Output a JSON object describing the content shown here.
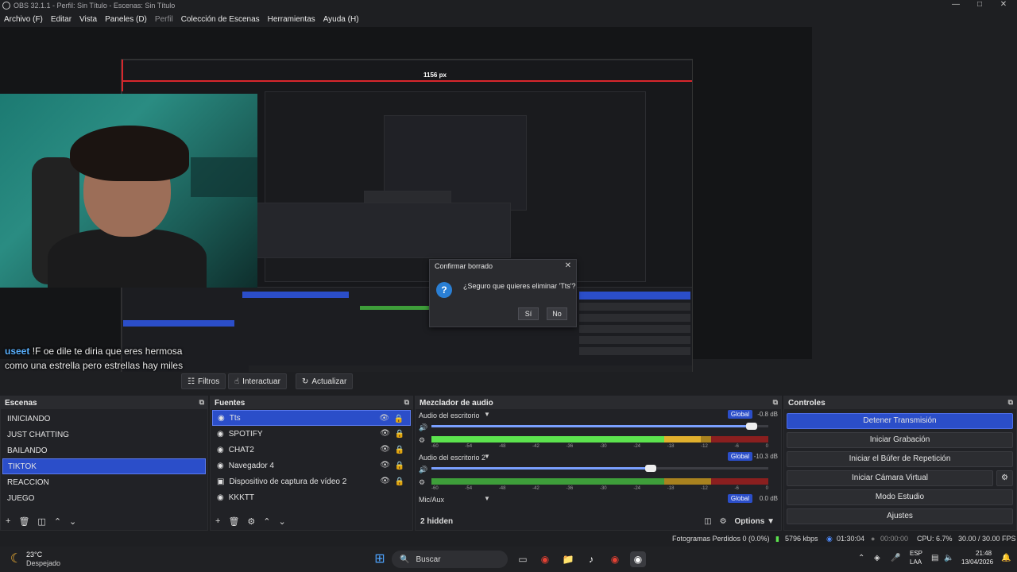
{
  "window": {
    "title": "OBS 32.1.1 - Perfil: Sin Título - Escenas: Sin Título"
  },
  "menu": [
    "Archivo (F)",
    "Editar",
    "Vista",
    "Paneles (D)",
    "Perfil",
    "Colección de Escenas",
    "Herramientas",
    "Ayuda (H)"
  ],
  "preview": {
    "measure_label": "1156 px"
  },
  "confirm": {
    "title": "Confirmar borrado",
    "message": "¿Seguro que quieres eliminar 'Tts'?",
    "yes": "Sí",
    "no": "No"
  },
  "chat": {
    "user": "useet",
    "message": "!F oe dile te diria que eres hermosa como una estrella pero estrellas hay miles mejor te digo que eres unica como la luna"
  },
  "toolbar": {
    "filters": "Filtros",
    "interact": "Interactuar",
    "refresh": "Actualizar"
  },
  "scenes": {
    "title": "Escenas",
    "items": [
      "IINICIANDO",
      "JUST CHATTING",
      "BAILANDO",
      "TIKTOK",
      "REACCION",
      "JUEGO"
    ],
    "selected_index": 3
  },
  "sources": {
    "title": "Fuentes",
    "items": [
      "Tts",
      "SPOTIFY",
      "CHAT2",
      "Navegador 4",
      "Dispositivo de captura de vídeo 2",
      "KKKTT"
    ],
    "selected_index": 0
  },
  "mixer": {
    "title": "Mezclador de audio",
    "global_label": "Global",
    "hidden_label": "2 hidden",
    "options_label": "Options",
    "ticks": [
      "-60",
      "-54",
      "-48",
      "-42",
      "-36",
      "-30",
      "-24",
      "-18",
      "-12",
      "-6",
      "0"
    ],
    "channels": [
      {
        "name": "Audio del escritorio",
        "db": "-0.8 dB",
        "volume": 0.95,
        "level": 0.8
      },
      {
        "name": "Audio del escritorio 2",
        "db": "-10.3 dB",
        "volume": 0.65,
        "level": 0.0
      },
      {
        "name": "Mic/Aux",
        "db": "0.0 dB",
        "volume": 1.0,
        "level": 0.0
      }
    ]
  },
  "controls": {
    "title": "Controles",
    "buttons": [
      "Detener Transmisión",
      "Iniciar Grabación",
      "Iniciar el Búfer de Repetición",
      "Iniciar Cámara Virtual",
      "Modo Estudio",
      "Ajustes"
    ]
  },
  "status": {
    "dropped": "Fotogramas Perdidos 0 (0.0%)",
    "kbps": "5796 kbps",
    "stream_time": "01:30:04",
    "rec_time": "00:00:00",
    "cpu": "CPU: 6.7%",
    "fps": "30.00 / 30.00 FPS"
  },
  "taskbar": {
    "weather_temp": "23°C",
    "weather_desc": "Despejado",
    "search": "Buscar",
    "lang_top": "ESP",
    "lang_bottom": "LAA",
    "time": "21:48",
    "date": "13/04/2026"
  },
  "colors": {
    "accent": "#2b4ec9",
    "bg": "#1e1f22",
    "panel": "#212226"
  }
}
